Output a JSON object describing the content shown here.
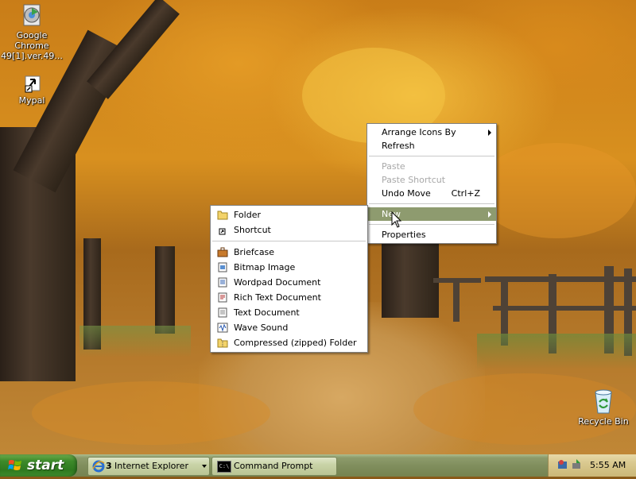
{
  "desktop": {
    "icons": [
      {
        "label": "Google Chrome 49[1].ver.49...",
        "icon": "chrome-installer-icon"
      },
      {
        "label": "Mypal",
        "icon": "mypal-shortcut-icon"
      },
      {
        "label": "Recycle Bin",
        "icon": "recycle-bin-icon"
      }
    ]
  },
  "context_menu": {
    "arrange_icons_by": "Arrange Icons By",
    "refresh": "Refresh",
    "paste": "Paste",
    "paste_shortcut": "Paste Shortcut",
    "undo_move": "Undo Move",
    "undo_move_shortcut": "Ctrl+Z",
    "new": "New",
    "properties": "Properties"
  },
  "new_submenu": {
    "folder": "Folder",
    "shortcut": "Shortcut",
    "briefcase": "Briefcase",
    "bitmap_image": "Bitmap Image",
    "wordpad_document": "Wordpad Document",
    "rich_text_document": "Rich Text Document",
    "text_document": "Text Document",
    "wave_sound": "Wave Sound",
    "compressed_folder": "Compressed (zipped) Folder"
  },
  "taskbar": {
    "start_label": "start",
    "tasks": [
      {
        "count": "3",
        "label": "Internet Explorer",
        "icon": "internet-explorer-icon"
      },
      {
        "label": "Command Prompt",
        "icon": "command-prompt-icon"
      }
    ],
    "clock": "5:55 AM"
  },
  "colors": {
    "menu_highlight": "#8e9b6f",
    "taskbar": "#7f8d5c",
    "start_button": "#3d8a2a"
  }
}
